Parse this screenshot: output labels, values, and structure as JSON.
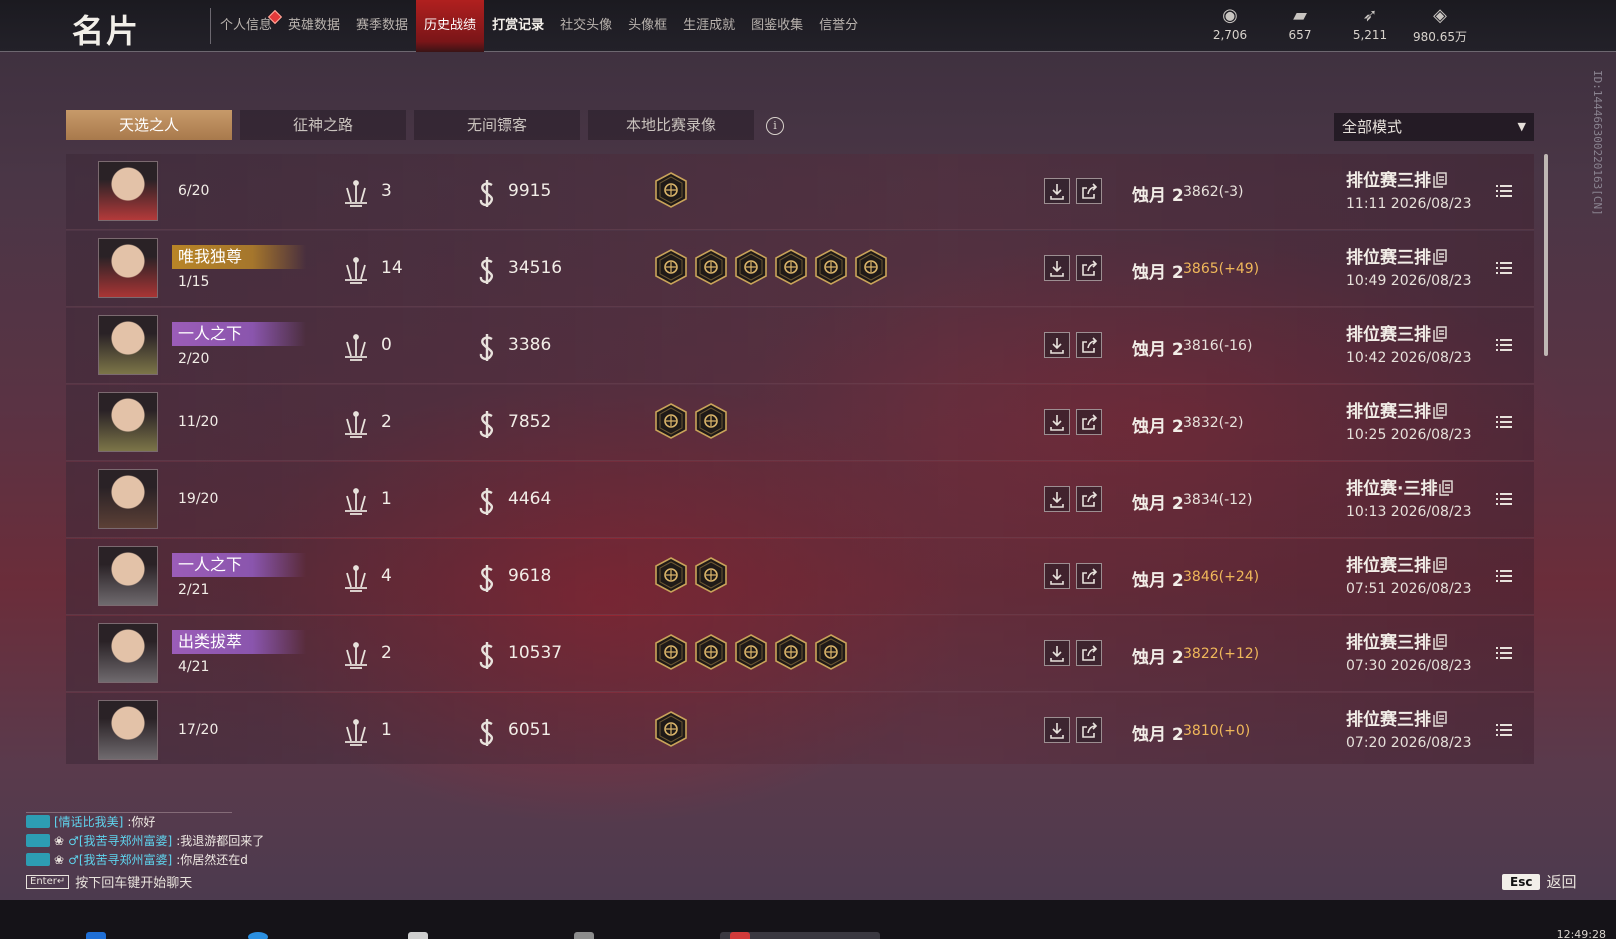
{
  "header": {
    "title": "名片",
    "nav": [
      {
        "label": "个人信息",
        "active": false,
        "bold": false,
        "dot": true
      },
      {
        "label": "英雄数据",
        "active": false,
        "bold": false,
        "dot": false
      },
      {
        "label": "赛季数据",
        "active": false,
        "bold": false,
        "dot": false
      },
      {
        "label": "历史战绩",
        "active": true,
        "bold": false,
        "dot": false
      },
      {
        "label": "打赏记录",
        "active": false,
        "bold": true,
        "dot": false
      },
      {
        "label": "社交头像",
        "active": false,
        "bold": false,
        "dot": false
      },
      {
        "label": "头像框",
        "active": false,
        "bold": false,
        "dot": false
      },
      {
        "label": "生涯成就",
        "active": false,
        "bold": false,
        "dot": false
      },
      {
        "label": "图鉴收集",
        "active": false,
        "bold": false,
        "dot": false
      },
      {
        "label": "信誉分",
        "active": false,
        "bold": false,
        "dot": false
      }
    ],
    "currencies": [
      {
        "icon": "eye-coin-icon",
        "value": "2,706"
      },
      {
        "icon": "gold-ticket-icon",
        "value": "657"
      },
      {
        "icon": "feather-icon",
        "value": "5,211"
      },
      {
        "icon": "diamond-icon",
        "value": "980.65万"
      }
    ]
  },
  "side_id": "ID:144466300220163[CN]",
  "tabs": [
    {
      "label": "天选之人",
      "active": true
    },
    {
      "label": "征神之路",
      "active": false
    },
    {
      "label": "无间镖客",
      "active": false
    },
    {
      "label": "本地比赛录像",
      "active": false
    }
  ],
  "mode_select": {
    "value": "全部模式"
  },
  "matches": [
    {
      "portrait": "#b43a3a",
      "title": "",
      "title_style": "",
      "rank": "6/20",
      "kills": "3",
      "money": "9915",
      "badges": 1,
      "tier": "蚀月 2",
      "score": "3862(-3)",
      "score_up": false,
      "mode": "排位赛三排",
      "time": "11:11  2026/08/23"
    },
    {
      "portrait": "#a93535",
      "title": "唯我独尊",
      "title_style": "gold",
      "rank": "1/15",
      "kills": "14",
      "money": "34516",
      "badges": 6,
      "tier": "蚀月 2",
      "score": "3865(+49)",
      "score_up": true,
      "mode": "排位赛三排",
      "time": "10:49  2026/08/23"
    },
    {
      "portrait": "#7c7548",
      "title": "一人之下",
      "title_style": "purple",
      "rank": "2/20",
      "kills": "0",
      "money": "3386",
      "badges": 0,
      "tier": "蚀月 2",
      "score": "3816(-16)",
      "score_up": false,
      "mode": "排位赛三排",
      "time": "10:42  2026/08/23"
    },
    {
      "portrait": "#7c7548",
      "title": "",
      "title_style": "",
      "rank": "11/20",
      "kills": "2",
      "money": "7852",
      "badges": 2,
      "tier": "蚀月 2",
      "score": "3832(-2)",
      "score_up": false,
      "mode": "排位赛三排",
      "time": "10:25  2026/08/23"
    },
    {
      "portrait": "#5c4036",
      "title": "",
      "title_style": "",
      "rank": "19/20",
      "kills": "1",
      "money": "4464",
      "badges": 0,
      "tier": "蚀月 2",
      "score": "3834(-12)",
      "score_up": false,
      "mode": "排位赛·三排",
      "time": "10:13  2026/08/23"
    },
    {
      "portrait": "#6f6a6e",
      "title": "一人之下",
      "title_style": "purple",
      "rank": "2/21",
      "kills": "4",
      "money": "9618",
      "badges": 2,
      "tier": "蚀月 2",
      "score": "3846(+24)",
      "score_up": true,
      "mode": "排位赛三排",
      "time": "07:51  2026/08/23"
    },
    {
      "portrait": "#6f6a6e",
      "title": "出类拔萃",
      "title_style": "purple",
      "rank": "4/21",
      "kills": "2",
      "money": "10537",
      "badges": 5,
      "tier": "蚀月 2",
      "score": "3822(+12)",
      "score_up": true,
      "mode": "排位赛三排",
      "time": "07:30  2026/08/23"
    },
    {
      "portrait": "#6f6a6e",
      "title": "",
      "title_style": "",
      "rank": "17/20",
      "kills": "1",
      "money": "6051",
      "badges": 1,
      "tier": "蚀月 2",
      "score": "3810(+0)",
      "score_up": true,
      "mode": "排位赛三排",
      "time": "07:20  2026/08/23"
    }
  ],
  "chat": {
    "lines": [
      {
        "name": "[情话比我美]",
        "text": ":你好",
        "lotus": false
      },
      {
        "name": "♂[我苦寻郑州富婆]",
        "text": ":我退游都回来了",
        "lotus": true
      },
      {
        "name": "♂[我苦寻郑州富婆]",
        "text": ":你居然还在d",
        "lotus": true
      }
    ],
    "enter_key": "Enter↵",
    "hint": "按下回车键开始聊天"
  },
  "back": {
    "key": "Esc",
    "label": "返回"
  },
  "taskbar": {
    "clock": "12:49:28"
  }
}
